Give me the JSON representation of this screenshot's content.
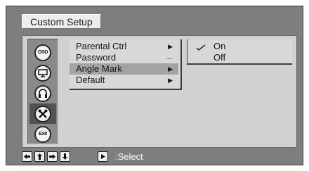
{
  "title": "Custom Setup",
  "sidebar": {
    "items": [
      {
        "icon": "osd-disc-icon",
        "label": "OSD",
        "active": false
      },
      {
        "icon": "monitor-icon",
        "label": "",
        "active": false
      },
      {
        "icon": "headphones-icon",
        "label": "",
        "active": false
      },
      {
        "icon": "tools-icon",
        "label": "",
        "active": true
      },
      {
        "icon": "exit-icon",
        "label": "Exit",
        "active": false
      }
    ]
  },
  "menu": {
    "items": [
      {
        "label": "Parental Ctrl",
        "indicator": "arrow",
        "highlighted": false
      },
      {
        "label": "Password",
        "indicator": "dots",
        "highlighted": false
      },
      {
        "label": "Angle Mark",
        "indicator": "arrow",
        "highlighted": true
      },
      {
        "label": "Default",
        "indicator": "arrow",
        "highlighted": false
      }
    ]
  },
  "submenu": {
    "items": [
      {
        "label": "On",
        "selected": true
      },
      {
        "label": "Off",
        "selected": false
      }
    ]
  },
  "status": {
    "keys": [
      "left-arrow-key-icon",
      "up-arrow-key-icon",
      "right-arrow-key-icon",
      "down-arrow-key-icon",
      "play-key-icon"
    ],
    "text": ":Select"
  },
  "colors": {
    "screen_bg": "#7e7e7e",
    "panel_bg": "#d1d1d1",
    "highlight": "#a3a3a3",
    "active_icon_bg": "#525252"
  }
}
